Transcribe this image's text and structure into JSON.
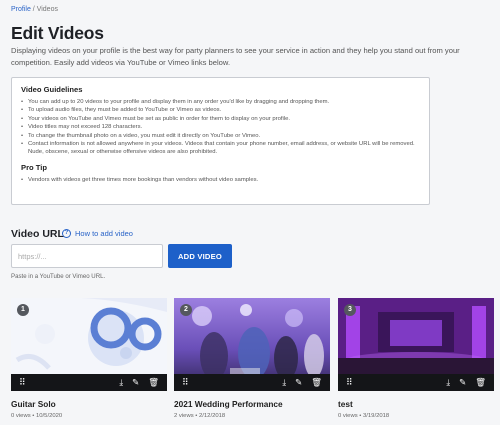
{
  "breadcrumb": {
    "profile": "Profile",
    "separator": " / ",
    "current": "Videos"
  },
  "page_title": "Edit Videos",
  "intro": "Displaying videos on your profile is the best way for party planners to see your service in action and they help you stand out from your competition. Easily add videos via YouTube or Vimeo links below.",
  "guidelines": {
    "heading": "Video Guidelines",
    "items": [
      "You can add up to 20 videos to your profile and display them in any order you'd like by dragging and dropping them.",
      "To upload audio files, they must be added to YouTube or Vimeo as videos.",
      "Your videos on YouTube and Vimeo must be set as public in order for them to display on your profile.",
      "Video titles may not exceed 128 characters.",
      "To change the thumbnail photo on a video, you must edit it directly on YouTube or Vimeo.",
      "Contact information is not allowed anywhere in your videos. Videos that contain your phone number, email address, or website URL will be removed. Nude, obscene, sexual or otherwise offensive videos are also prohibited."
    ],
    "tip_heading": "Pro Tip",
    "tip": "Vendors with videos get three times more bookings than vendors without video samples."
  },
  "video_url": {
    "label": "Video URL",
    "help_icon": "question-circle-icon",
    "help_text": "How to add video",
    "placeholder": "https://...",
    "value": "",
    "button": "ADD VIDEO",
    "hint": "Paste in a YouTube or Vimeo URL."
  },
  "colors": {
    "accent": "#1d60c9",
    "link": "#2a64c8",
    "toolbar": "#141518"
  },
  "icons": {
    "drag": "drag-handle-icon",
    "download": "download-icon",
    "edit": "pencil-icon",
    "delete": "trash-icon"
  },
  "videos": [
    {
      "number": "1",
      "title": "Guitar Solo",
      "meta": "0 views • 10/5/2020"
    },
    {
      "number": "2",
      "title": "2021 Wedding Performance",
      "meta": "2 views • 2/12/2018"
    },
    {
      "number": "3",
      "title": "test",
      "meta": "0 views • 3/19/2018"
    }
  ]
}
